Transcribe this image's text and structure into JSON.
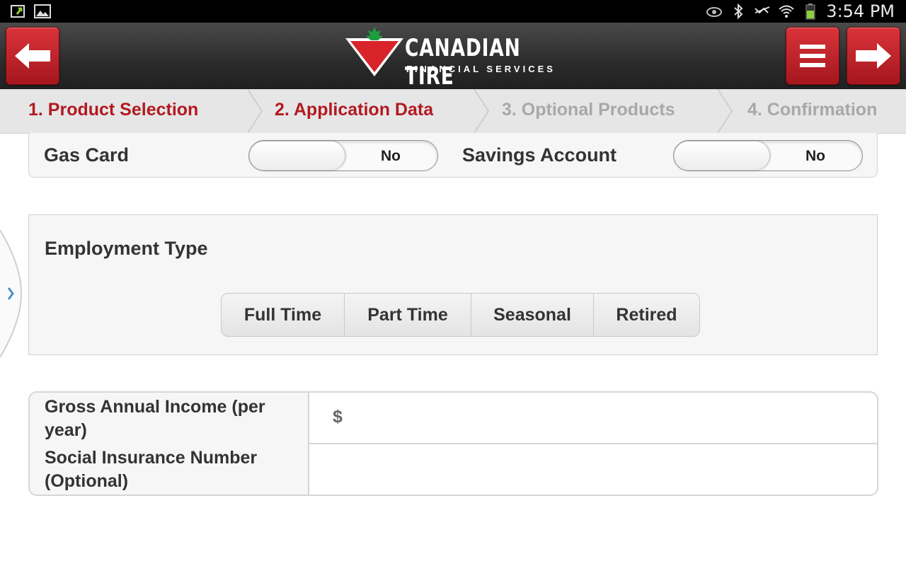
{
  "status_bar": {
    "time": "3:54 PM",
    "left_icons": [
      "sync-icon",
      "gallery-icon"
    ],
    "right_icons": [
      "eye-icon",
      "bluetooth-icon",
      "nfc-muted-icon",
      "wifi-icon",
      "battery-icon"
    ]
  },
  "header": {
    "logo_title": "CANADIAN TIRE",
    "logo_subtitle": "FINANCIAL SERVICES",
    "brand_color": "#c8202a"
  },
  "steps": [
    {
      "label": "1. Product Selection",
      "state": "active"
    },
    {
      "label": "2. Application Data",
      "state": "active"
    },
    {
      "label": "3. Optional Products",
      "state": "inactive"
    },
    {
      "label": "4. Confirmation",
      "state": "inactive"
    }
  ],
  "toggles": {
    "gas_card": {
      "label": "Gas Card",
      "value": "No"
    },
    "savings_account": {
      "label": "Savings Account",
      "value": "No"
    }
  },
  "employment": {
    "title": "Employment Type",
    "options": [
      "Full Time",
      "Part Time",
      "Seasonal",
      "Retired"
    ]
  },
  "form": {
    "income_label": "Gross Annual Income (per year)",
    "currency_symbol": "$",
    "income_value": "",
    "sin_label": "Social Insurance Number (Optional)",
    "sin_value": ""
  }
}
